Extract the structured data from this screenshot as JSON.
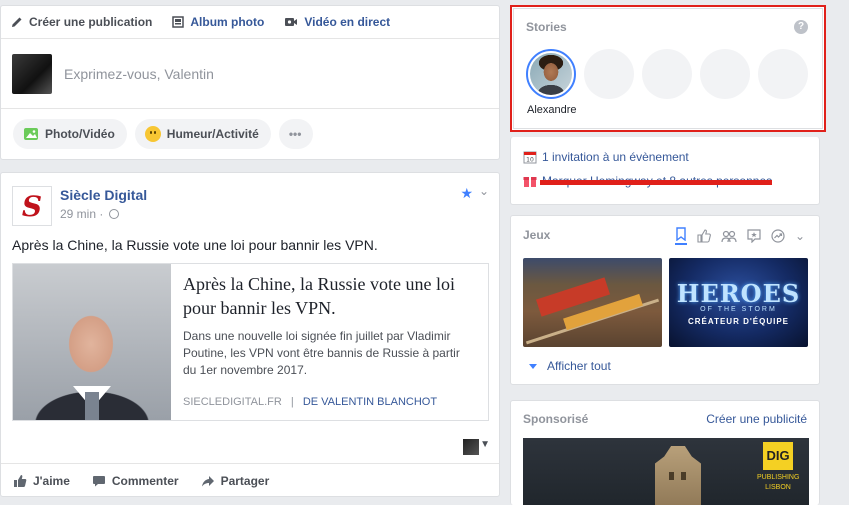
{
  "composer": {
    "tabs": [
      {
        "label": "Créer une publication",
        "icon": "pencil-icon"
      },
      {
        "label": "Album photo",
        "icon": "album-icon"
      },
      {
        "label": "Vidéo en direct",
        "icon": "video-camera-icon"
      }
    ],
    "placeholder": "Exprimez-vous, Valentin",
    "actions": [
      {
        "label": "Photo/Vidéo",
        "icon": "photo-icon"
      },
      {
        "label": "Humeur/Activité",
        "icon": "smiley-icon"
      }
    ],
    "more": "•••"
  },
  "post": {
    "author": "Siècle Digital",
    "logo_letter": "S",
    "time": "29 min ·",
    "text": "Après la Chine, la Russie vote une loi pour bannir les VPN.",
    "link": {
      "title": "Après la Chine, la Russie vote une loi pour bannir les VPN.",
      "description": "Dans une nouvelle loi signée fin juillet par Vladimir Poutine, les VPN vont être bannis de Russie à partir du 1er novembre 2017.",
      "source": "SIECLEDIGITAL.FR",
      "separator": "|",
      "author": "DE VALENTIN BLANCHOT"
    },
    "actions": {
      "like": "J'aime",
      "comment": "Commenter",
      "share": "Partager"
    }
  },
  "stories": {
    "title": "Stories",
    "help": "?",
    "first_name": "Alexandre"
  },
  "events": {
    "invitation": "1 invitation à un évènement",
    "birthday": "Marquer Hemingway et 8 autres personnes"
  },
  "games": {
    "title": "Jeux",
    "tiles": [
      {
        "name": "train-game"
      },
      {
        "name": "heroes-of-the-storm",
        "logo": "HEROES",
        "sub": "OF THE STORM",
        "caption": "CRÉATEUR D'ÉQUIPE"
      }
    ],
    "show_all": "Afficher tout"
  },
  "sponsored": {
    "title": "Sponsorisé",
    "create": "Créer une publicité",
    "ad_logo": "DIG",
    "ad_sub1": "PUBLISHING",
    "ad_sub2": "LISBON"
  },
  "colors": {
    "link_blue": "#365899",
    "accent_blue": "#4080ff",
    "highlight_red": "#e0201a",
    "background": "#e9ebee"
  }
}
